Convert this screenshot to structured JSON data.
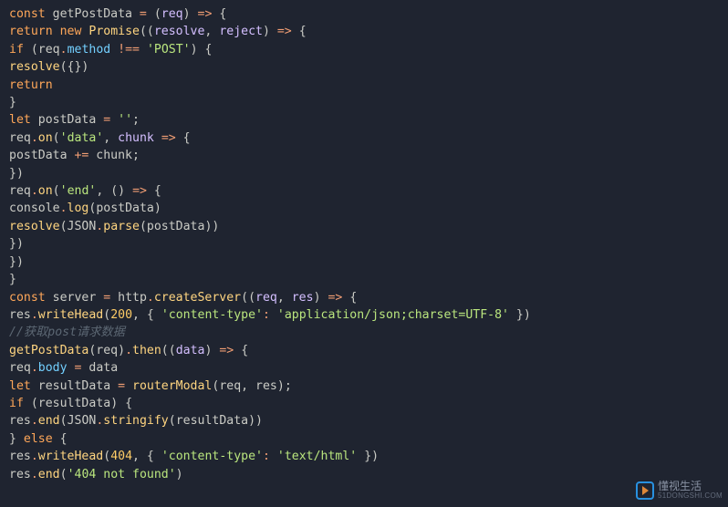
{
  "code_lines": [
    [
      [
        "kw",
        "const"
      ],
      [
        "id",
        " getPostData "
      ],
      [
        "op",
        "="
      ],
      [
        "id",
        " "
      ],
      [
        "par",
        "("
      ],
      [
        "var",
        "req"
      ],
      [
        "par",
        ")"
      ],
      [
        "id",
        " "
      ],
      [
        "op",
        "=>"
      ],
      [
        "id",
        " "
      ],
      [
        "par",
        "{"
      ]
    ],
    [
      [
        "kw",
        "return"
      ],
      [
        "id",
        " "
      ],
      [
        "kw",
        "new"
      ],
      [
        "id",
        " "
      ],
      [
        "fn",
        "Promise"
      ],
      [
        "par",
        "(("
      ],
      [
        "var",
        "resolve"
      ],
      [
        "id",
        ", "
      ],
      [
        "var",
        "reject"
      ],
      [
        "par",
        ")"
      ],
      [
        "id",
        " "
      ],
      [
        "op",
        "=>"
      ],
      [
        "id",
        " "
      ],
      [
        "par",
        "{"
      ]
    ],
    [
      [
        "kw",
        "if"
      ],
      [
        "id",
        " "
      ],
      [
        "par",
        "("
      ],
      [
        "id",
        "req"
      ],
      [
        "op",
        "."
      ],
      [
        "prop",
        "method"
      ],
      [
        "id",
        " "
      ],
      [
        "op",
        "!=="
      ],
      [
        "id",
        " "
      ],
      [
        "str",
        "'POST'"
      ],
      [
        "par",
        ")"
      ],
      [
        "id",
        " "
      ],
      [
        "par",
        "{"
      ]
    ],
    [
      [
        "fn",
        "resolve"
      ],
      [
        "par",
        "({})"
      ]
    ],
    [
      [
        "kw",
        "return"
      ]
    ],
    [
      [
        "par",
        "}"
      ]
    ],
    [
      [
        "kw",
        "let"
      ],
      [
        "id",
        " postData "
      ],
      [
        "op",
        "="
      ],
      [
        "id",
        " "
      ],
      [
        "str",
        "''"
      ],
      [
        "id",
        ";"
      ]
    ],
    [
      [
        "id",
        "req"
      ],
      [
        "op",
        "."
      ],
      [
        "fn",
        "on"
      ],
      [
        "par",
        "("
      ],
      [
        "str",
        "'data'"
      ],
      [
        "id",
        ", "
      ],
      [
        "var",
        "chunk"
      ],
      [
        "id",
        " "
      ],
      [
        "op",
        "=>"
      ],
      [
        "id",
        " "
      ],
      [
        "par",
        "{"
      ]
    ],
    [
      [
        "id",
        "postData "
      ],
      [
        "op",
        "+="
      ],
      [
        "id",
        " chunk;"
      ]
    ],
    [
      [
        "par",
        "})"
      ]
    ],
    [
      [
        "id",
        "req"
      ],
      [
        "op",
        "."
      ],
      [
        "fn",
        "on"
      ],
      [
        "par",
        "("
      ],
      [
        "str",
        "'end'"
      ],
      [
        "id",
        ", "
      ],
      [
        "par",
        "()"
      ],
      [
        "id",
        " "
      ],
      [
        "op",
        "=>"
      ],
      [
        "id",
        " "
      ],
      [
        "par",
        "{"
      ]
    ],
    [
      [
        "id",
        "console"
      ],
      [
        "op",
        "."
      ],
      [
        "fn",
        "log"
      ],
      [
        "par",
        "("
      ],
      [
        "id",
        "postData"
      ],
      [
        "par",
        ")"
      ]
    ],
    [
      [
        "fn",
        "resolve"
      ],
      [
        "par",
        "("
      ],
      [
        "id",
        "JSON"
      ],
      [
        "op",
        "."
      ],
      [
        "fn",
        "parse"
      ],
      [
        "par",
        "("
      ],
      [
        "id",
        "postData"
      ],
      [
        "par",
        "))"
      ]
    ],
    [
      [
        "par",
        "})"
      ]
    ],
    [
      [
        "par",
        "})"
      ]
    ],
    [
      [
        "par",
        "}"
      ]
    ],
    [
      [
        "kw",
        "const"
      ],
      [
        "id",
        " server "
      ],
      [
        "op",
        "="
      ],
      [
        "id",
        " http"
      ],
      [
        "op",
        "."
      ],
      [
        "fn",
        "createServer"
      ],
      [
        "par",
        "(("
      ],
      [
        "var",
        "req"
      ],
      [
        "id",
        ", "
      ],
      [
        "var",
        "res"
      ],
      [
        "par",
        ")"
      ],
      [
        "id",
        " "
      ],
      [
        "op",
        "=>"
      ],
      [
        "id",
        " "
      ],
      [
        "par",
        "{"
      ]
    ],
    [
      [
        "id",
        "res"
      ],
      [
        "op",
        "."
      ],
      [
        "fn",
        "writeHead"
      ],
      [
        "par",
        "("
      ],
      [
        "num",
        "200"
      ],
      [
        "id",
        ", "
      ],
      [
        "par",
        "{"
      ],
      [
        "id",
        " "
      ],
      [
        "str",
        "'content-type'"
      ],
      [
        "op",
        ":"
      ],
      [
        "id",
        " "
      ],
      [
        "str",
        "'application/json;charset=UTF-8'"
      ],
      [
        "id",
        " "
      ],
      [
        "par",
        "})"
      ]
    ],
    [
      [
        "cm",
        "//获取post请求数据"
      ]
    ],
    [
      [
        "fn",
        "getPostData"
      ],
      [
        "par",
        "("
      ],
      [
        "id",
        "req"
      ],
      [
        "par",
        ")"
      ],
      [
        "op",
        "."
      ],
      [
        "fn",
        "then"
      ],
      [
        "par",
        "(("
      ],
      [
        "var",
        "data"
      ],
      [
        "par",
        ")"
      ],
      [
        "id",
        " "
      ],
      [
        "op",
        "=>"
      ],
      [
        "id",
        " "
      ],
      [
        "par",
        "{"
      ]
    ],
    [
      [
        "id",
        "req"
      ],
      [
        "op",
        "."
      ],
      [
        "prop",
        "body"
      ],
      [
        "id",
        " "
      ],
      [
        "op",
        "="
      ],
      [
        "id",
        " data"
      ]
    ],
    [
      [
        "kw",
        "let"
      ],
      [
        "id",
        " resultData "
      ],
      [
        "op",
        "="
      ],
      [
        "id",
        " "
      ],
      [
        "fn",
        "routerModal"
      ],
      [
        "par",
        "("
      ],
      [
        "id",
        "req"
      ],
      [
        "id",
        ", "
      ],
      [
        "id",
        "res"
      ],
      [
        "par",
        ")"
      ],
      [
        "id",
        ";"
      ]
    ],
    [
      [
        "kw",
        "if"
      ],
      [
        "id",
        " "
      ],
      [
        "par",
        "("
      ],
      [
        "id",
        "resultData"
      ],
      [
        "par",
        ")"
      ],
      [
        "id",
        " "
      ],
      [
        "par",
        "{"
      ]
    ],
    [
      [
        "id",
        "res"
      ],
      [
        "op",
        "."
      ],
      [
        "fn",
        "end"
      ],
      [
        "par",
        "("
      ],
      [
        "id",
        "JSON"
      ],
      [
        "op",
        "."
      ],
      [
        "fn",
        "stringify"
      ],
      [
        "par",
        "("
      ],
      [
        "id",
        "resultData"
      ],
      [
        "par",
        "))"
      ]
    ],
    [
      [
        "par",
        "}"
      ],
      [
        "id",
        " "
      ],
      [
        "kw",
        "else"
      ],
      [
        "id",
        " "
      ],
      [
        "par",
        "{"
      ]
    ],
    [
      [
        "id",
        "res"
      ],
      [
        "op",
        "."
      ],
      [
        "fn",
        "writeHead"
      ],
      [
        "par",
        "("
      ],
      [
        "num",
        "404"
      ],
      [
        "id",
        ", "
      ],
      [
        "par",
        "{"
      ],
      [
        "id",
        " "
      ],
      [
        "str",
        "'content-type'"
      ],
      [
        "op",
        ":"
      ],
      [
        "id",
        " "
      ],
      [
        "str",
        "'text/html'"
      ],
      [
        "id",
        " "
      ],
      [
        "par",
        "})"
      ]
    ],
    [
      [
        "id",
        "res"
      ],
      [
        "op",
        "."
      ],
      [
        "fn",
        "end"
      ],
      [
        "par",
        "("
      ],
      [
        "str",
        "'404 not found'"
      ],
      [
        "par",
        ")"
      ]
    ]
  ],
  "watermark": {
    "line1": "懂视生活",
    "line2": "51DONGSHI.COM"
  }
}
